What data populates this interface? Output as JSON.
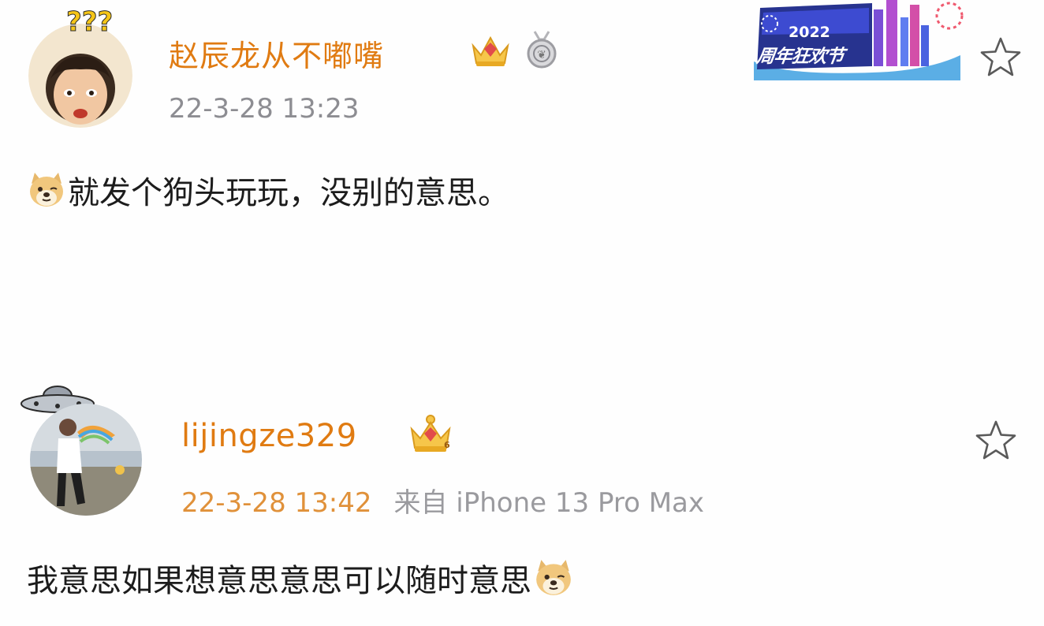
{
  "posts": [
    {
      "username": "赵辰龙从不嘟嘴",
      "timestamp": "22-3-28 13:23",
      "content": "就发个狗头玩玩，没别的意思。",
      "badges": [
        "crown-badge",
        "medal-badge"
      ],
      "leading_emoji": "doge-emoji"
    },
    {
      "username": "lijingze329",
      "timestamp": "22-3-28 13:42",
      "source": "来自 iPhone 13 Pro Max",
      "content": "我意思如果想意思意思可以随时意思",
      "badges": [
        "crown-badge"
      ],
      "trailing_emoji": "doge-emoji"
    }
  ],
  "banner": {
    "year": "2022",
    "text": "周年狂欢节"
  },
  "colors": {
    "username": "#e07b12",
    "timestamp_gray": "#8d8d92",
    "timestamp_orange": "#e0913a",
    "content": "#1c1c1c",
    "star": "#5a5a5a"
  }
}
